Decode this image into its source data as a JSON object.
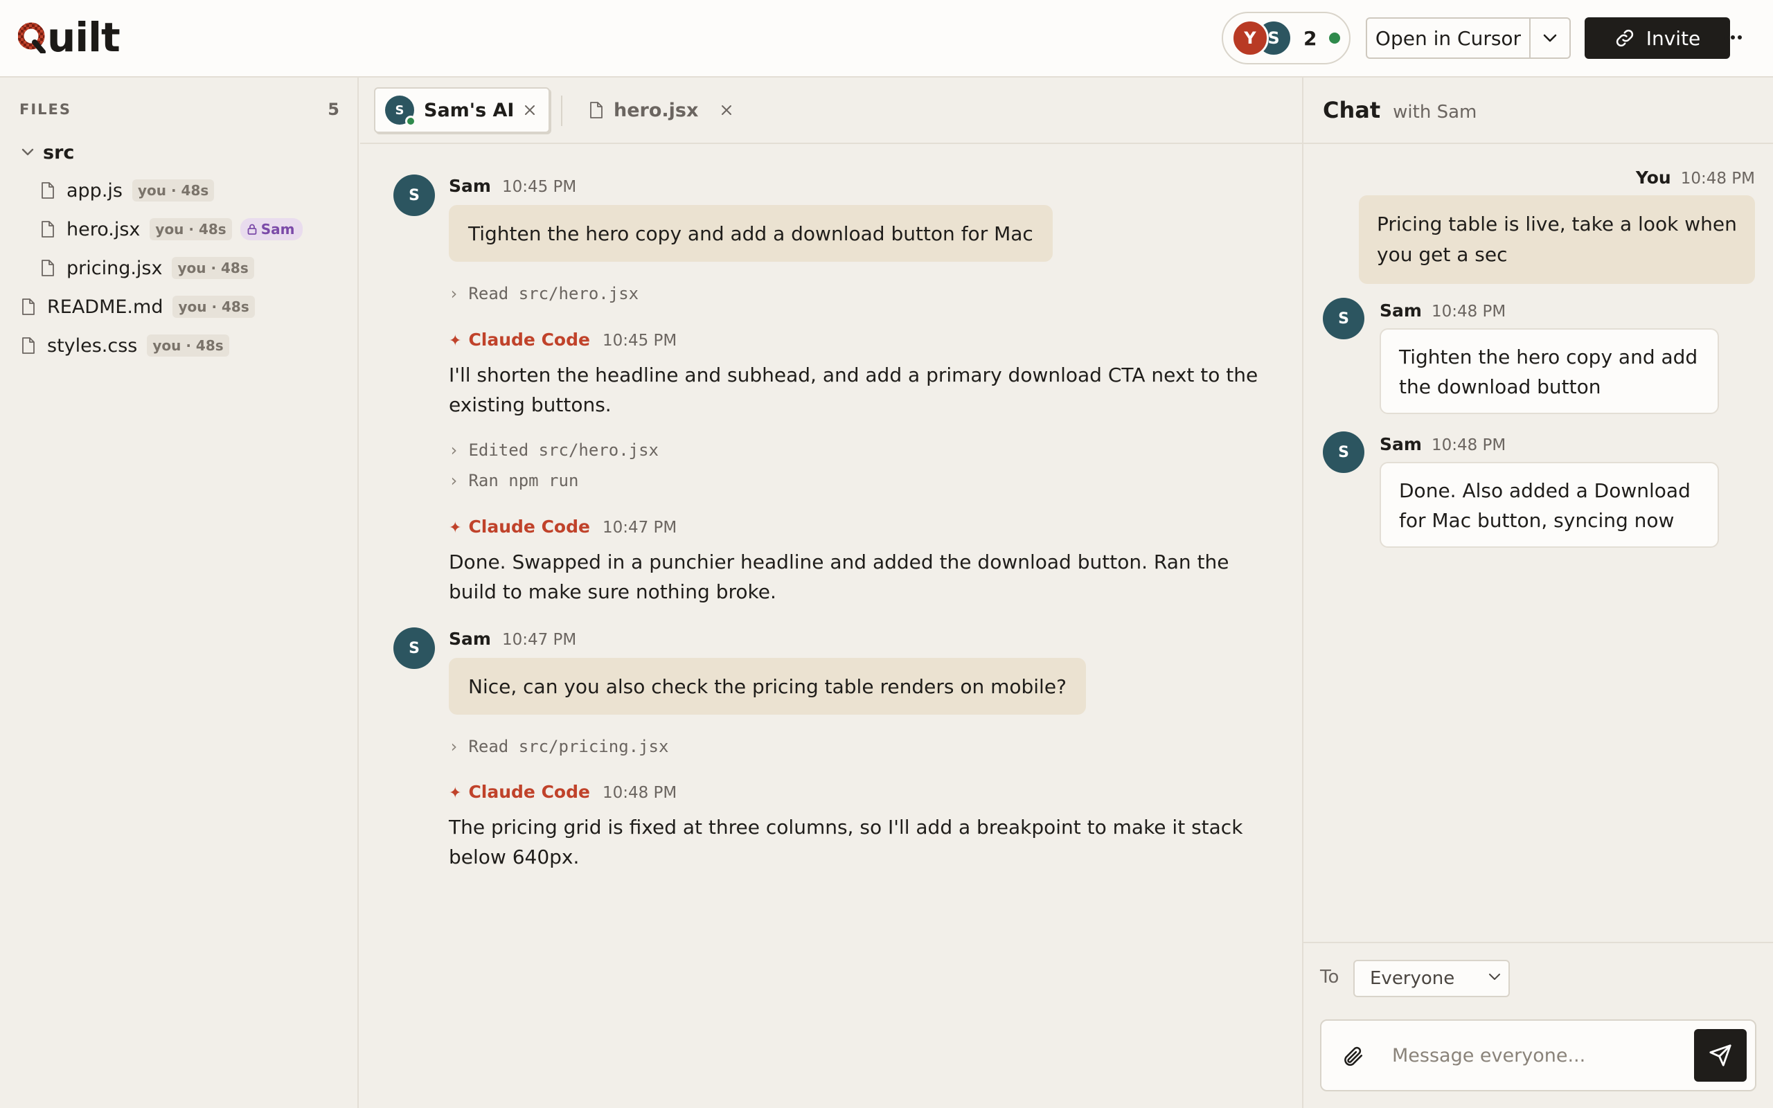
{
  "header": {
    "logo_text": "uilt",
    "presence": {
      "avatar_1": "Y",
      "avatar_2": "S",
      "count": "2"
    },
    "open_in_label": "Open in Cursor",
    "invite_label": "Invite"
  },
  "sidebar": {
    "title": "FILES",
    "count": "5",
    "folder": "src",
    "files": [
      {
        "name": "app.js",
        "meta": "you · 48s"
      },
      {
        "name": "hero.jsx",
        "meta": "you · 48s",
        "lock": "Sam"
      },
      {
        "name": "pricing.jsx",
        "meta": "you · 48s"
      },
      {
        "name": "README.md",
        "meta": "you · 48s"
      },
      {
        "name": "styles.css",
        "meta": "you · 48s"
      }
    ]
  },
  "tabs": [
    {
      "label": "Sam's AI",
      "avatar": "S"
    },
    {
      "label": "hero.jsx"
    }
  ],
  "conversation": {
    "m1": {
      "avatar": "S",
      "author": "Sam",
      "time": "10:45 PM",
      "text": "Tighten the hero copy and add a download button for Mac"
    },
    "t1": "Read src/hero.jsx",
    "c1": {
      "author": "Claude Code",
      "time": "10:45 PM",
      "text": "I'll shorten the headline and subhead, and add a primary download CTA next to the existing buttons."
    },
    "t2": "Edited src/hero.jsx",
    "t3": "Ran npm run",
    "c2": {
      "author": "Claude Code",
      "time": "10:47 PM",
      "text": "Done. Swapped in a punchier headline and added the download button. Ran the build to make sure nothing broke."
    },
    "m2": {
      "avatar": "S",
      "author": "Sam",
      "time": "10:47 PM",
      "text": "Nice, can you also check the pricing table renders on mobile?"
    },
    "t4": "Read src/pricing.jsx",
    "c3": {
      "author": "Claude Code",
      "time": "10:48 PM",
      "text": "The pricing grid is fixed at three columns, so I'll add a breakpoint to make it stack below 640px."
    }
  },
  "chat": {
    "title": "Chat",
    "subtitle": "with Sam",
    "you": {
      "author": "You",
      "time": "10:48 PM",
      "text": "Pricing table is live, take a look when you get a sec"
    },
    "sam1": {
      "avatar": "S",
      "author": "Sam",
      "time": "10:48 PM",
      "text": "Tighten the hero copy and add the download button"
    },
    "sam2": {
      "avatar": "S",
      "author": "Sam",
      "time": "10:48 PM",
      "text": "Done. Also added a Download for Mac button, syncing now"
    },
    "to_label": "To",
    "to_value": "Everyone",
    "placeholder": "Message everyone..."
  },
  "colors": {
    "accent_red": "#c0422a",
    "dark": "#1f1d1a",
    "avatar_teal": "#2c5560",
    "online_green": "#2f8a4c",
    "lock_purple": "#7b4aa8"
  }
}
